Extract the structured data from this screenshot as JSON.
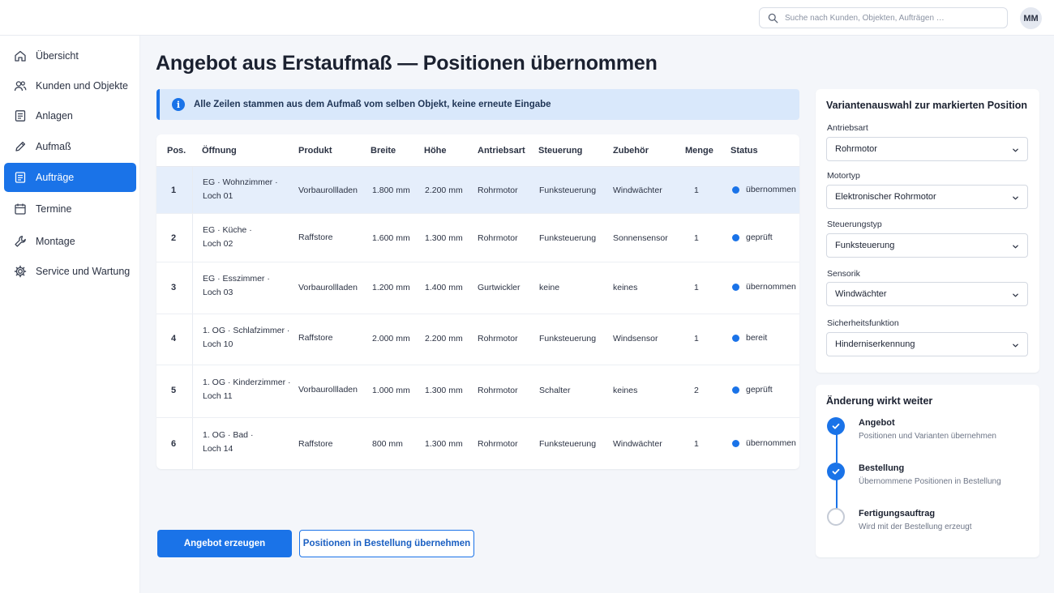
{
  "topbar": {
    "search_placeholder": "Suche nach Kunden, Objekten, Aufträgen …",
    "user_initials": "MM"
  },
  "sidebar": {
    "items": [
      {
        "label": "Übersicht",
        "icon": "home-icon"
      },
      {
        "label": "Kunden und Objekte",
        "icon": "users-icon"
      },
      {
        "label": "Anlagen",
        "icon": "document-icon"
      },
      {
        "label": "Aufmaß",
        "icon": "pencil-icon"
      },
      {
        "label": "Aufträge",
        "icon": "clipboard-icon",
        "active": true
      },
      {
        "label": "Termine",
        "icon": "calendar-icon"
      },
      {
        "label": "Montage",
        "icon": "wrench-icon"
      },
      {
        "label": "Service und Wartung",
        "icon": "gear-icon"
      }
    ]
  },
  "main": {
    "title": "Angebot aus Erstaufmaß — Positionen übernommen",
    "info_text": "Alle Zeilen stammen aus dem Aufmaß vom selben Objekt, keine erneute Eingabe",
    "table": {
      "headers": [
        "Pos.",
        "Öffnung",
        "Produkt",
        "Breite",
        "Höhe",
        "Antriebsart",
        "Steuerung",
        "Zubehör",
        "Menge",
        "Status"
      ],
      "rows": [
        {
          "pos": "1",
          "opening_line1": "EG · Wohnzimmer ·",
          "opening_line2": "Loch 01",
          "product": "Vorbaurollladen",
          "width": "1.800 mm",
          "height": "2.200 mm",
          "drive": "Rohrmotor",
          "control": "Funksteuerung",
          "accessory": "Windwächter",
          "qty": "1",
          "status": "übernommen",
          "selected": true
        },
        {
          "pos": "2",
          "opening_line1": "EG · Küche ·",
          "opening_line2": "Loch 02",
          "product": "Raffstore",
          "width": "1.600 mm",
          "height": "1.300 mm",
          "drive": "Rohrmotor",
          "control": "Funksteuerung",
          "accessory": "Sonnensensor",
          "qty": "1",
          "status": "geprüft"
        },
        {
          "pos": "3",
          "opening_line1": "EG · Esszimmer ·",
          "opening_line2": "Loch 03",
          "product": "Vorbaurollladen",
          "width": "1.200 mm",
          "height": "1.400 mm",
          "drive": "Gurtwickler",
          "control": "keine",
          "accessory": "keines",
          "qty": "1",
          "status": "übernommen"
        },
        {
          "pos": "4",
          "opening_line1": "1. OG · Schlafzimmer ·",
          "opening_line2": "Loch 10",
          "product": "Raffstore",
          "width": "2.000 mm",
          "height": "2.200 mm",
          "drive": "Rohrmotor",
          "control": "Funksteuerung",
          "accessory": "Windsensor",
          "qty": "1",
          "status": "bereit"
        },
        {
          "pos": "5",
          "opening_line1": "1. OG · Kinderzimmer ·",
          "opening_line2": "Loch 11",
          "product": "Vorbaurollladen",
          "width": "1.000 mm",
          "height": "1.300 mm",
          "drive": "Rohrmotor",
          "control": "Schalter",
          "accessory": "keines",
          "qty": "2",
          "status": "geprüft"
        },
        {
          "pos": "6",
          "opening_line1": "1. OG · Bad ·",
          "opening_line2": "Loch 14",
          "product": "Raffstore",
          "width": "800 mm",
          "height": "1.300 mm",
          "drive": "Rohrmotor",
          "control": "Funksteuerung",
          "accessory": "Windwächter",
          "qty": "1",
          "status": "übernommen"
        }
      ]
    },
    "actions": {
      "primary": "Angebot erzeugen",
      "secondary": "Positionen in Bestellung übernehmen"
    }
  },
  "variant_panel": {
    "title": "Variantenauswahl zur markierten Position",
    "fields": [
      {
        "label": "Antriebsart",
        "value": "Rohrmotor"
      },
      {
        "label": "Motortyp",
        "value": "Elektronischer Rohrmotor"
      },
      {
        "label": "Steuerungstyp",
        "value": "Funksteuerung"
      },
      {
        "label": "Sensorik",
        "value": "Windwächter"
      },
      {
        "label": "Sicherheitsfunktion",
        "value": "Hinderniserkennung"
      }
    ]
  },
  "impact_panel": {
    "title": "Änderung wirkt weiter",
    "steps": [
      {
        "title": "Angebot",
        "subtitle": "Positionen und Varianten übernehmen",
        "done": true
      },
      {
        "title": "Bestellung",
        "subtitle": "Übernommene Positionen in Bestellung",
        "done": true
      },
      {
        "title": "Fertigungsauftrag",
        "subtitle": "Wird mit der Bestellung erzeugt",
        "done": false
      }
    ]
  },
  "colors": {
    "accent": "#1a73e8",
    "selected_row": "#e5eefb",
    "info_banner": "#d9e8fb"
  }
}
